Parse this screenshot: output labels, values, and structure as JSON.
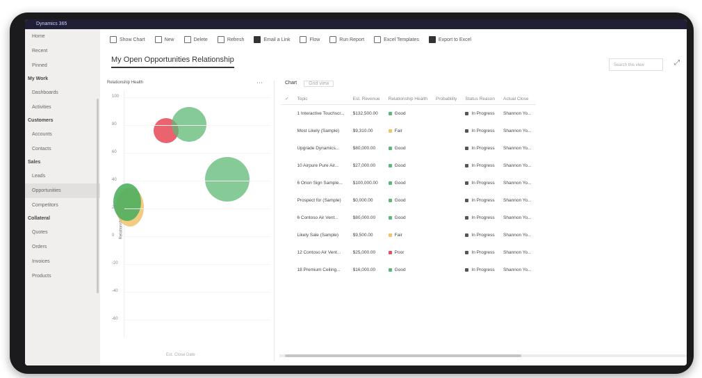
{
  "titlebar": {
    "app": "Dynamics 365"
  },
  "sidebar": {
    "items": [
      {
        "label": "Home",
        "type": "item"
      },
      {
        "label": "Recent",
        "type": "item"
      },
      {
        "label": "Pinned",
        "type": "item"
      },
      {
        "label": "My Work",
        "type": "group"
      },
      {
        "label": "Dashboards",
        "type": "item"
      },
      {
        "label": "Activities",
        "type": "item"
      },
      {
        "label": "Customers",
        "type": "group"
      },
      {
        "label": "Accounts",
        "type": "item"
      },
      {
        "label": "Contacts",
        "type": "item"
      },
      {
        "label": "Sales",
        "type": "group"
      },
      {
        "label": "Leads",
        "type": "item"
      },
      {
        "label": "Opportunities",
        "type": "item",
        "active": true
      },
      {
        "label": "Competitors",
        "type": "item"
      },
      {
        "label": "Collateral",
        "type": "group"
      },
      {
        "label": "Quotes",
        "type": "item"
      },
      {
        "label": "Orders",
        "type": "item"
      },
      {
        "label": "Invoices",
        "type": "item"
      },
      {
        "label": "Products",
        "type": "item"
      }
    ]
  },
  "commandbar": {
    "items": [
      "Show Chart",
      "New",
      "Delete",
      "Refresh",
      "Email a Link",
      "Flow",
      "Run Report",
      "Excel Templates",
      "Export to Excel"
    ]
  },
  "view": {
    "title": "My Open Opportunities Relationship",
    "search_placeholder": "Search this view"
  },
  "chart": {
    "title": "Relationship Health",
    "y_ticks": [
      "100",
      "80",
      "60",
      "40",
      "20",
      "0",
      "-20",
      "-40",
      "-60"
    ],
    "y_label": "Relationship health",
    "x_label": "Est. Close Date"
  },
  "grid": {
    "tabs": [
      "Chart",
      "Grid view"
    ],
    "columns": [
      "Topic",
      "Est. Revenue",
      "Relationship Health",
      "Probability",
      "Status Reason",
      "Actual Close"
    ],
    "rows": [
      {
        "topic": "1 Interactive Touchscr...",
        "revenue": "$132,500.00",
        "health": "Good",
        "prob": "",
        "status": "In Progress",
        "owner": "Shannon Yo..."
      },
      {
        "topic": "Most Likely (Sample)",
        "revenue": "$9,310.00",
        "health": "Fair",
        "prob": "",
        "status": "In Progress",
        "owner": "Shannon Yo..."
      },
      {
        "topic": "Upgrade Dynamics...",
        "revenue": "$80,000.00",
        "health": "Good",
        "prob": "",
        "status": "In Progress",
        "owner": "Shannon Yo..."
      },
      {
        "topic": "10 Airpure Pure Air...",
        "revenue": "$27,000.00",
        "health": "Good",
        "prob": "",
        "status": "In Progress",
        "owner": "Shannon Yo..."
      },
      {
        "topic": "6 Orion Sign Sample...",
        "revenue": "$100,000.00",
        "health": "Good",
        "prob": "",
        "status": "In Progress",
        "owner": "Shannon Yo..."
      },
      {
        "topic": "Prospect for (Sample)",
        "revenue": "$0,000.00",
        "health": "Good",
        "prob": "",
        "status": "In Progress",
        "owner": "Shannon Yo..."
      },
      {
        "topic": "6 Contoso Air Vent...",
        "revenue": "$80,000.00",
        "health": "Good",
        "prob": "",
        "status": "In Progress",
        "owner": "Shannon Yo..."
      },
      {
        "topic": "Likely Sale (Sample)",
        "revenue": "$9,500.00",
        "health": "Fair",
        "prob": "",
        "status": "In Progress",
        "owner": "Shannon Yo..."
      },
      {
        "topic": "12 Contoso Air Vent...",
        "revenue": "$25,000.00",
        "health": "Poor",
        "prob": "",
        "status": "In Progress",
        "owner": "Shannon Yo..."
      },
      {
        "topic": "18 Premium Ceiling...",
        "revenue": "$16,000.00",
        "health": "Good",
        "prob": "",
        "status": "In Progress",
        "owner": "Shannon Yo..."
      }
    ]
  },
  "colors": {
    "good": "#5cb874",
    "poor": "#e8525f",
    "fair": "#f2c36b",
    "accent": "#201f35"
  }
}
